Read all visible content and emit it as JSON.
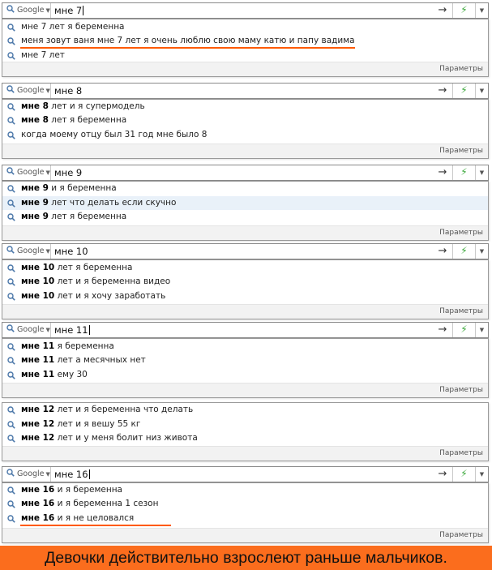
{
  "params_label": "Параметры",
  "engine_label": "Google",
  "icons": {
    "search": "magnifier-icon",
    "go": "arrow-right-icon",
    "extension": "green-extension-icon",
    "dropdown": "dropdown-caret-icon",
    "engine_caret": "engine-caret-icon"
  },
  "colors": {
    "underline": "#ff5a00",
    "caption_bg": "#fb6d1d",
    "highlight_row": "#e9f1f9",
    "extension_icon": "#3aa83a"
  },
  "panels": [
    {
      "query": "мне 7",
      "suggestions": [
        {
          "bold": "",
          "text": "мне 7 лет я беременна"
        },
        {
          "bold": "",
          "text": "меня зовут ваня мне 7 лет я очень люблю свою маму катю и папу вадима"
        },
        {
          "bold": "",
          "text": "мне 7 лет"
        }
      ]
    },
    {
      "query": "мне 8",
      "suggestions": [
        {
          "bold": "мне 8",
          "text": " лет и я супермодель"
        },
        {
          "bold": "мне 8",
          "text": " лет я беременна"
        },
        {
          "bold": "",
          "text": "когда моему отцу был 31 год мне было 8"
        }
      ]
    },
    {
      "query": "мне 9",
      "suggestions": [
        {
          "bold": "мне 9",
          "text": " и я беременна"
        },
        {
          "bold": "мне 9",
          "text": " лет что делать если скучно"
        },
        {
          "bold": "мне 9",
          "text": " лет я беременна"
        }
      ]
    },
    {
      "query": "мне 10",
      "suggestions": [
        {
          "bold": "мне 10",
          "text": " лет я беременна"
        },
        {
          "bold": "мне 10",
          "text": " лет и я беременна видео"
        },
        {
          "bold": "мне 10",
          "text": " лет и я хочу заработать"
        }
      ]
    },
    {
      "query": "мне 11",
      "suggestions": [
        {
          "bold": "мне 11",
          "text": " я беременна"
        },
        {
          "bold": "мне 11",
          "text": " лет а месячных нет"
        },
        {
          "bold": "мне 11",
          "text": " ему 30"
        }
      ]
    },
    {
      "query": "",
      "suggestions": [
        {
          "bold": "мне 12",
          "text": " лет и я беременна что делать"
        },
        {
          "bold": "мне 12",
          "text": " лет и я вешу 55 кг"
        },
        {
          "bold": "мне 12",
          "text": " лет и у меня болит низ живота"
        }
      ]
    },
    {
      "query": "мне 16",
      "suggestions": [
        {
          "bold": "мне 16",
          "text": " и я беременна"
        },
        {
          "bold": "мне 16",
          "text": " и я беременна 1 сезон"
        },
        {
          "bold": "мне 16",
          "text": " и я не целовался"
        }
      ]
    }
  ],
  "caption": "Девочки действительно взрослеют раньше мальчиков."
}
